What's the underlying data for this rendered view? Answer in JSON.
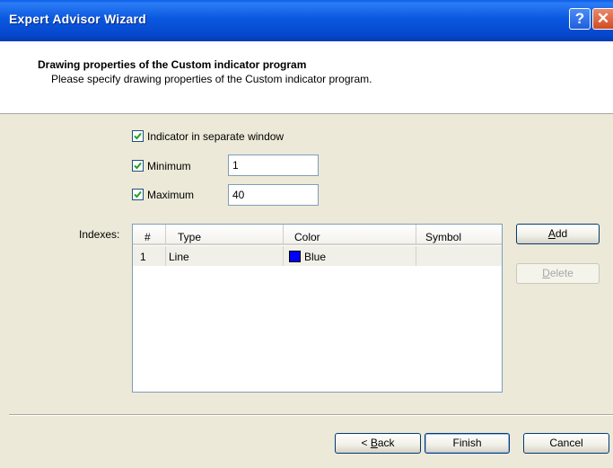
{
  "window": {
    "title": "Expert Advisor Wizard",
    "help_label": "?",
    "close_label": "✕"
  },
  "header": {
    "heading": "Drawing properties of the Custom indicator program",
    "subheading": "Please specify drawing properties of the Custom indicator program."
  },
  "options": {
    "separate_window": {
      "label": "Indicator in separate window",
      "checked": true
    },
    "minimum": {
      "label": "Minimum",
      "checked": true,
      "value": "1"
    },
    "maximum": {
      "label": "Maximum",
      "checked": true,
      "value": "40"
    }
  },
  "indexes": {
    "label": "Indexes:",
    "columns": [
      "#",
      "Type",
      "Color",
      "Symbol"
    ],
    "rows": [
      {
        "num": "1",
        "type": "Line",
        "color": "Blue",
        "color_hex": "#0000ff",
        "symbol": ""
      }
    ]
  },
  "side_buttons": {
    "add": {
      "label": "Add",
      "mnemonic": "A",
      "rest": "dd"
    },
    "delete": {
      "label": "Delete",
      "mnemonic": "D",
      "rest": "elete"
    }
  },
  "footer": {
    "back": {
      "label": "< Back",
      "prefix": "< ",
      "mnemonic": "B",
      "rest": "ack"
    },
    "finish": "Finish",
    "cancel": "Cancel"
  }
}
